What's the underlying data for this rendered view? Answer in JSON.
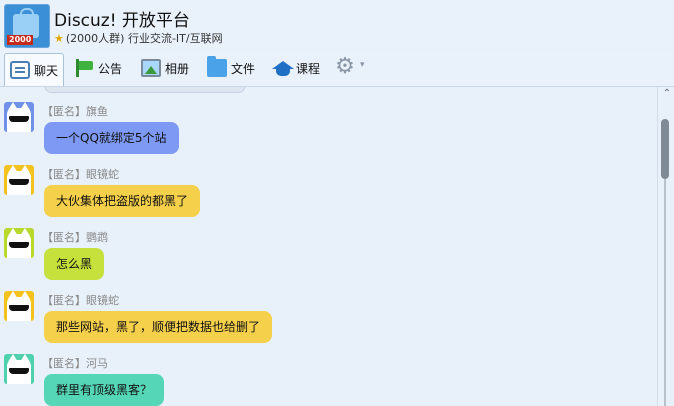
{
  "header": {
    "avatar_badge": "2000",
    "title": "Discuz! 开放平台",
    "meta": "(2000人群) 行业交流-IT/互联网",
    "star_icon": "star-icon"
  },
  "toolbar": {
    "tabs": [
      {
        "label": "聊天",
        "icon": "chat-icon",
        "active": true
      },
      {
        "label": "公告",
        "icon": "flag-icon",
        "active": false
      },
      {
        "label": "相册",
        "icon": "album-icon",
        "active": false
      },
      {
        "label": "文件",
        "icon": "folder-icon",
        "active": false
      },
      {
        "label": "课程",
        "icon": "graduation-cap-icon",
        "active": false
      }
    ],
    "settings_icon": "gear-icon",
    "settings_glyph": "⚙",
    "caret_glyph": "▾"
  },
  "messages": [
    {
      "sender": "【匿名】旗鱼",
      "text": "一个QQ就绑定5个站",
      "avatar_color": "#6f92e8",
      "bubble_color": "#7d99f3"
    },
    {
      "sender": "【匿名】眼镜蛇",
      "text": "大伙集体把盗版的都黑了",
      "avatar_color": "#f4c21c",
      "bubble_color": "#f5d04a"
    },
    {
      "sender": "【匿名】鹦鹉",
      "text": "怎么黑",
      "avatar_color": "#b8d82b",
      "bubble_color": "#c6e03c"
    },
    {
      "sender": "【匿名】眼镜蛇",
      "text": "那些网站，黑了，顺便把数据也给删了",
      "avatar_color": "#f4c21c",
      "bubble_color": "#f5d04a"
    },
    {
      "sender": "【匿名】河马",
      "text": "群里有顶级黑客？",
      "avatar_color": "#4fd1ae",
      "bubble_color": "#55d6b6"
    }
  ],
  "scrollbar": {
    "up_glyph": "⌃"
  }
}
